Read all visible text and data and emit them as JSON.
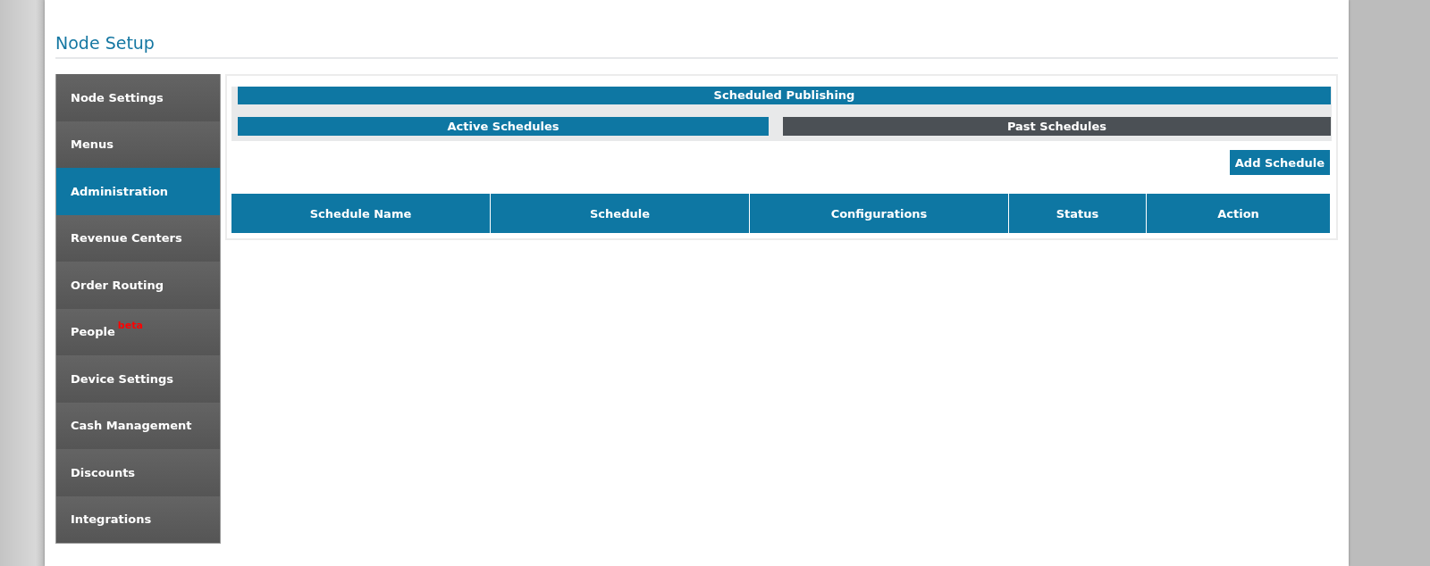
{
  "page_title": "Node Setup",
  "sidebar": {
    "items": [
      {
        "label": "Node Settings",
        "selected": false
      },
      {
        "label": "Menus",
        "selected": false
      },
      {
        "label": "Administration",
        "selected": true
      },
      {
        "label": "Revenue Centers",
        "selected": false
      },
      {
        "label": "Order Routing",
        "selected": false
      },
      {
        "label": "People",
        "badge": "beta",
        "selected": false
      },
      {
        "label": "Device Settings",
        "selected": false
      },
      {
        "label": "Cash Management",
        "selected": false
      },
      {
        "label": "Discounts",
        "selected": false
      },
      {
        "label": "Integrations",
        "selected": false
      }
    ]
  },
  "panel": {
    "title": "Scheduled Publishing",
    "tabs": [
      {
        "label": "Active Schedules",
        "selected": true
      },
      {
        "label": "Past Schedules",
        "selected": false
      }
    ],
    "add_button": "Add Schedule",
    "table": {
      "columns": [
        "Schedule Name",
        "Schedule",
        "Configurations",
        "Status",
        "Action"
      ]
    }
  }
}
